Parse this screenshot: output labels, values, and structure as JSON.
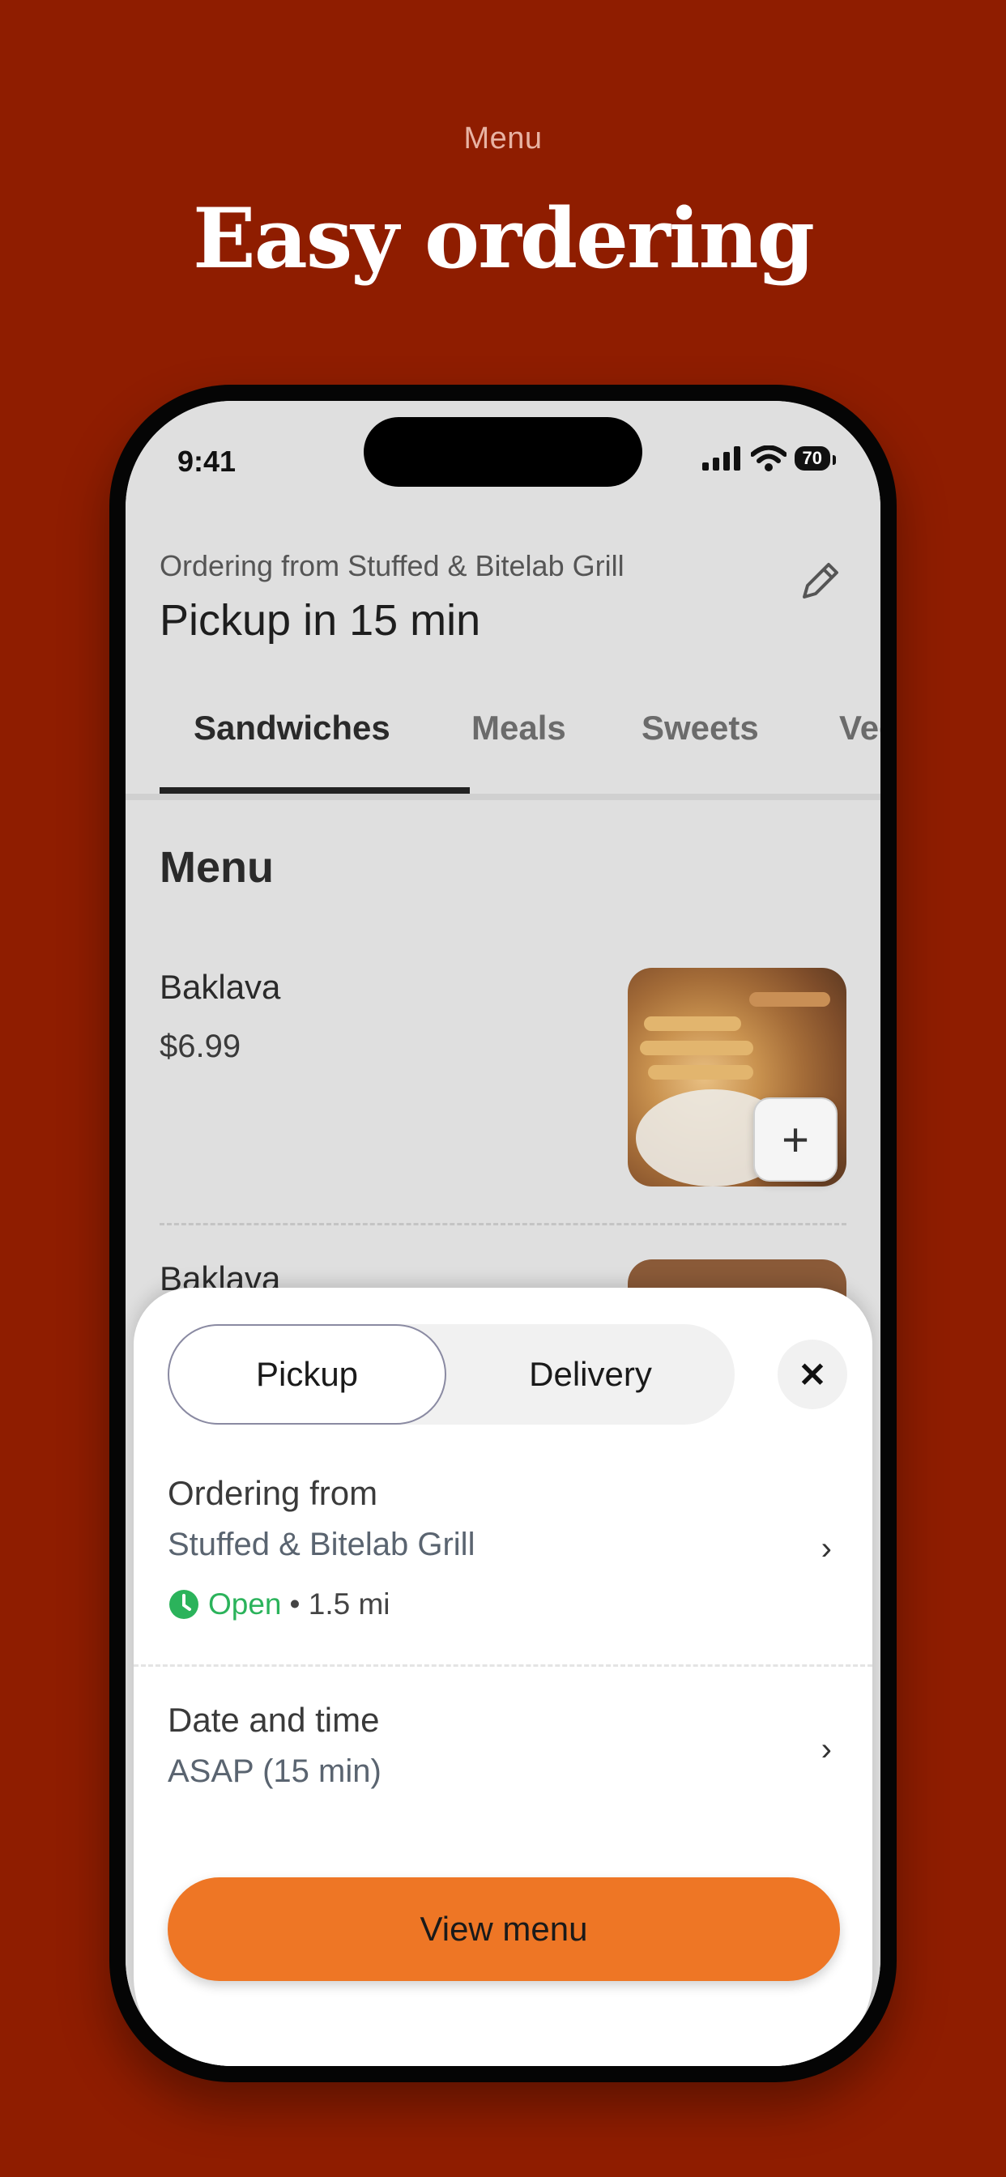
{
  "promo": {
    "eyebrow": "Menu",
    "title": "Easy ordering"
  },
  "status_bar": {
    "time": "9:41",
    "battery": "70"
  },
  "header": {
    "ordering_from": "Ordering from Stuffed & Bitelab Grill",
    "pickup_time": "Pickup in 15 min",
    "edit_icon": "pencil-icon"
  },
  "tabs": [
    {
      "label": "Sandwiches",
      "active": true
    },
    {
      "label": "Meals",
      "active": false
    },
    {
      "label": "Sweets",
      "active": false
    },
    {
      "label": "Veg",
      "active": false
    }
  ],
  "menu": {
    "heading": "Menu",
    "items": [
      {
        "name": "Baklava",
        "price": "$6.99",
        "add_icon": "plus-icon"
      },
      {
        "name": "Baklava",
        "price": ""
      }
    ]
  },
  "sheet": {
    "mode_options": [
      "Pickup",
      "Delivery"
    ],
    "selected_mode": "Pickup",
    "close_icon": "close-icon",
    "ordering_from": {
      "title": "Ordering from",
      "value": "Stuffed & Bitelab Grill",
      "status": "Open",
      "distance": "• 1.5 mi",
      "status_icon": "clock-icon",
      "status_color": "#2bb35b"
    },
    "date_time": {
      "title": "Date and time",
      "value": "ASAP (15 min)"
    },
    "cta": "View menu",
    "cta_color": "#ee7625"
  },
  "colors": {
    "background": "#8f1d00",
    "accent": "#ee7625"
  }
}
